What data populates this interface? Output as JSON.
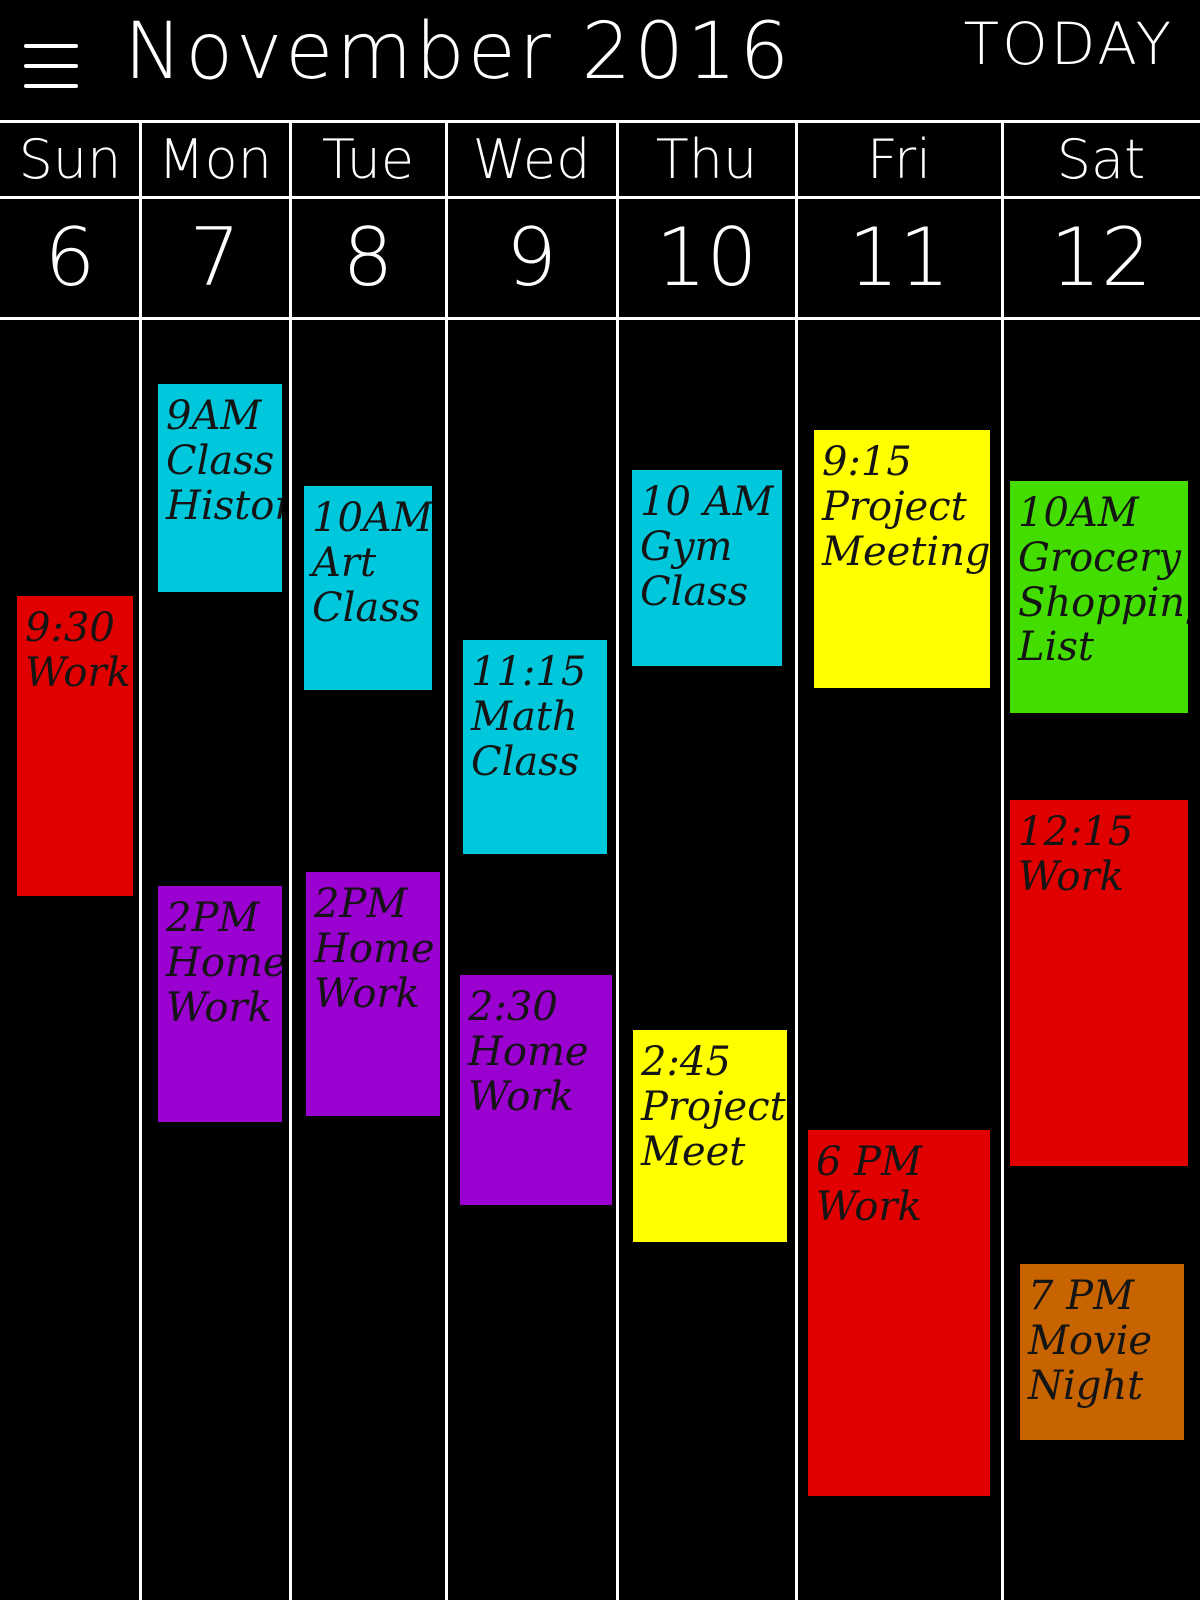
{
  "header": {
    "title": "November 2016",
    "today_label": "TODAY",
    "menu_icon": "hamburger-menu-icon"
  },
  "days": [
    {
      "name": "Sun",
      "number": "6"
    },
    {
      "name": "Mon",
      "number": "7"
    },
    {
      "name": "Tue",
      "number": "8"
    },
    {
      "name": "Wed",
      "number": "9"
    },
    {
      "name": "Thu",
      "number": "10"
    },
    {
      "name": "Fri",
      "number": "11"
    },
    {
      "name": "Sat",
      "number": "12"
    }
  ],
  "colors": {
    "cyan": "#00c8dc",
    "red": "#e00000",
    "purple": "#9a00d0",
    "yellow": "#ffff00",
    "green": "#44dd00",
    "orange": "#c86400"
  },
  "events": [
    {
      "day": "Sun",
      "time": "9:30",
      "title": "Work",
      "color": "#e00000"
    },
    {
      "day": "Mon",
      "time": "9AM",
      "title": "Class History",
      "color": "#00c8dc"
    },
    {
      "day": "Mon",
      "time": "2PM",
      "title": "Home Work",
      "color": "#9a00d0"
    },
    {
      "day": "Tue",
      "time": "10AM",
      "title": "Art Class",
      "color": "#00c8dc"
    },
    {
      "day": "Tue",
      "time": "2PM",
      "title": "Home Work",
      "color": "#9a00d0"
    },
    {
      "day": "Wed",
      "time": "11:15",
      "title": "Math Class",
      "color": "#00c8dc"
    },
    {
      "day": "Wed",
      "time": "2:30",
      "title": "Home Work",
      "color": "#9a00d0"
    },
    {
      "day": "Thu",
      "time": "10 AM",
      "title": "Gym Class",
      "color": "#00c8dc"
    },
    {
      "day": "Thu",
      "time": "2:45",
      "title": "Project Meet",
      "color": "#ffff00"
    },
    {
      "day": "Fri",
      "time": "9:15",
      "title": "Project Meeting",
      "color": "#ffff00"
    },
    {
      "day": "Fri",
      "time": "6 PM",
      "title": "Work",
      "color": "#e00000"
    },
    {
      "day": "Sat",
      "time": "10AM",
      "title": "Grocery Shopping List",
      "color": "#44dd00"
    },
    {
      "day": "Sat",
      "time": "12:15",
      "title": "Work",
      "color": "#e00000"
    },
    {
      "day": "Sat",
      "time": "7 PM",
      "title": "Movie Night",
      "color": "#c86400"
    }
  ]
}
